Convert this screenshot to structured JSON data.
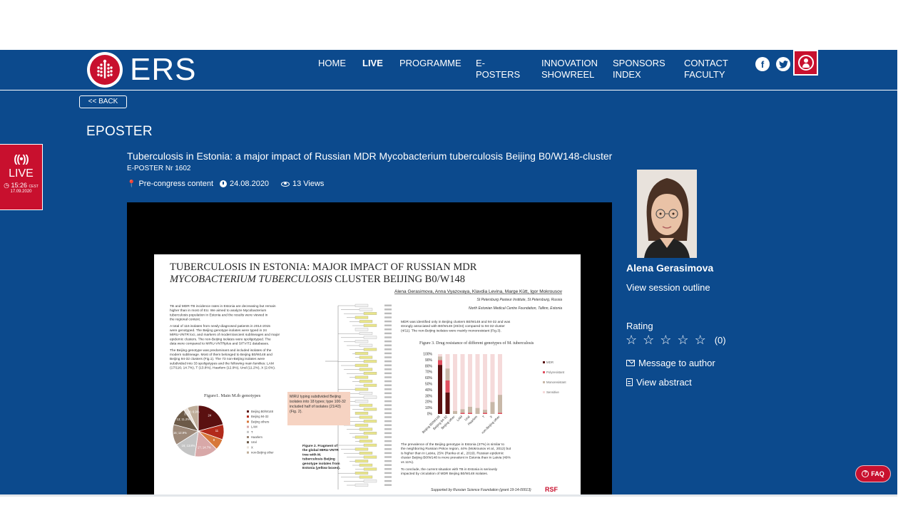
{
  "brand": {
    "logo_text": "ERS"
  },
  "nav": {
    "home": "HOME",
    "live": "LIVE",
    "programme": "PROGRAMME",
    "eposters": "E-POSTERS",
    "innovation": "INNOVATION\nSHOWREEL",
    "sponsors": "SPONSORS\nINDEX",
    "contact": "CONTACT\nFACULTY"
  },
  "icons": {
    "facebook": "facebook-icon",
    "twitter": "twitter-icon",
    "user": "user-icon",
    "pin": "pin-icon",
    "clock": "clock-icon",
    "eye": "eye-icon",
    "envelope": "envelope-icon",
    "file": "file-icon",
    "question": "question-icon",
    "broadcast": "broadcast-icon"
  },
  "back_label": "<< BACK",
  "section_title": "EPOSTER",
  "live_badge": {
    "label": "LIVE",
    "time": "15:26",
    "tz": "CEST",
    "date": "17.09.2020"
  },
  "poster": {
    "title": "Tuberculosis in Estonia: a major impact of Russian MDR Mycobacterium tuberculosis Beijing B0/W148-cluster",
    "number": "E-POSTER Nr 1602",
    "category": "Pre-congress content",
    "date": "24.08.2020",
    "views": "13 Views"
  },
  "poster_image": {
    "heading_line1": "TUBERCULOSIS IN ESTONIA: MAJOR IMPACT OF RUSSIAN MDR",
    "heading_line2_italic": "MYCOBACTERIUM TUBERCULOSIS",
    "heading_line2_rest": " CLUSTER BEIJING B0/W148",
    "authors": "Alena Gerasimova, Anna Vyazovaya, Klavdia Levina, Marge Kütt, Igor Mokrousov",
    "affil1": "St Petersburg Pasteur Institute, St Petersburg, Russia",
    "affil2": "North Estonian Medical Centre Foundation, Tallinn, Estonia",
    "fig1_caption": "Figure1. Main M.tb genotypes",
    "fig3_caption": "Figure 3. Drug resistance of different genotypes of M. tuberculosis",
    "miru_box": "MIRU typing subdivided Beijing isolates into 18 types; type 100-32 included half of isolates (21/43) (Fig. 2).",
    "fig2_caption": "Figure 2. Fragment of the global MIRU-VNTR tree with M. tuberculosis Beijing genotype isolates from Estonia (yellow boxes).",
    "footer": "Supported by Russian Science Foundation (grant 19-14-00013)",
    "rsf": "RSF",
    "paragraph1": "TB and MDR-TB incidence rates in Estonia are decreasing but remain higher than in most of EU. We aimed to analyze Mycobacterium tuberculosis population in Estonia and the results were viewed in the regional context.",
    "paragraph2": "A total of 116 isolates from newly-diagnosed patients in 2014-2015 were genotyped. The Beijing genotype isolates were typed in 24 MIRU-VNTR loci, and markers of modern/ancient sublineages and major epidemic clusters. The non-Beijing isolates were spoligotyped. The data were compared to MIRU-VNTRplus and SITVIT2 databases.",
    "paragraph3": "The Beijing genotype was predominant and included isolates of the modern sublineage. Most of them belonged to Beijing B0/W148 and Beijing 94-32 clusters (Fig.1). The 73 non-Beijing isolates were subdivided into 33 spoligotypes and the following main families: LAM (17/116; 14.7%), T (13.8%), Haarlem (12.9%), Ural (11.2%), X (2.6%).",
    "mdr_text": "MDR was identified only in Beijing clusters B0/W148 and 94-32 and was strongly associated with B0/W148 (20/24) compared to 94-32-cluster (4/11). The non-Beijing isolates were mainly monoresistant (Fig.3).",
    "prevalence_text": "The prevalence of the Beijing genotype in Estonia (37%) is similar to the neighboring Russian Pskov region, 44% (Mokrousov et al., 2012) but is higher than in Latvia, 25% (Ranka et al., 2019). Russian epidemic cluster Beijing B0/W148 is more prevalent in Estonia than in Latvia (49% vs 11%).",
    "conclude_text": "To conclude, the current situation with TB in Estonia is seriously impacted by circulation of MDR Beijing B0/W148 isolates.",
    "pie_legend": [
      "Beijing B0/W148",
      "Beijing 94-32",
      "Beijing others",
      "LAM",
      "T",
      "Haarlem",
      "Ural",
      "X",
      "non-Beijing other"
    ],
    "pie_labels": [
      "24",
      "11",
      "8",
      "17; 14.7%",
      "16; 13.8%",
      "15; 12.9%",
      "13; 11.2%",
      "3; 2.6%",
      "8; 6.9%"
    ],
    "bar_legend": [
      "MDR",
      "Polyresistant",
      "Monoresistant",
      "Sensitive"
    ],
    "bar_categories": [
      "Beijing B0/W148",
      "Beijing 94-32",
      "Beijing other",
      "LAM",
      "Ural",
      "Haarlem",
      "T",
      "X",
      "non-Beijing other"
    ],
    "bar_ticks": [
      "100%",
      "90%",
      "80%",
      "70%",
      "60%",
      "50%",
      "40%",
      "30%",
      "20%",
      "10%",
      "0%"
    ]
  },
  "author": {
    "name": "Alena Gerasimova",
    "session_link": "View session outline"
  },
  "rating": {
    "label": "Rating",
    "count": "(0)",
    "stars": 0,
    "max": 5
  },
  "actions": {
    "message": "Message to author",
    "abstract": "View abstract"
  },
  "faq": "FAQ",
  "colors": {
    "brand_blue": "#0c4a8d",
    "brand_red": "#c8102e"
  }
}
